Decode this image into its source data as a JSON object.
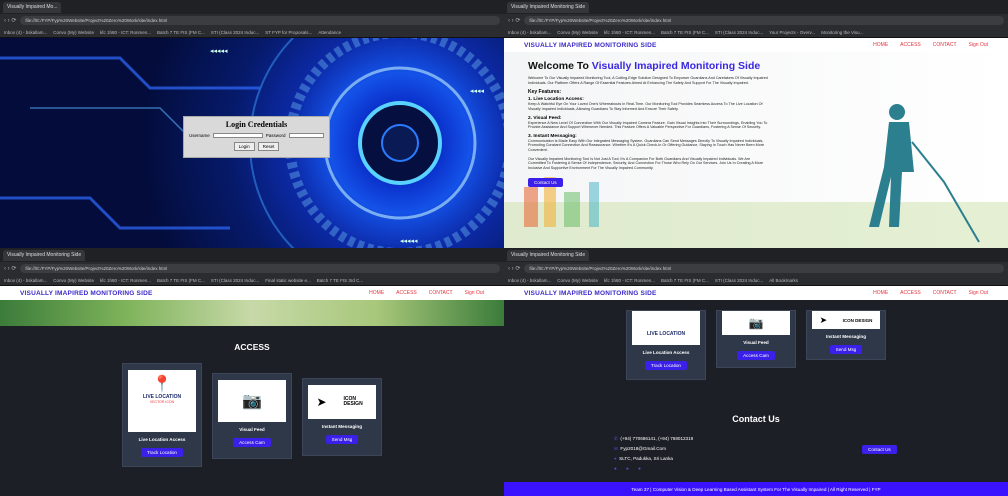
{
  "browser": {
    "tabs": [
      "Visually Impaired Mo...",
      "Visually Impaired Monitoring Side"
    ],
    "url": "file:///E:/FYP/Fyp%20Website/Project%20Zero%20Work/site/index.html",
    "bookmarks": [
      "Inbox (4) - bskallam...",
      "Convo (My) Website",
      "kfc 1h80 - ICT: Ronmen...",
      "Batch 7 TE FIS (FM C...",
      "STI (Class 2024 Induc...",
      "ST FYP for Proposals...",
      "Attendance",
      "Your Projects - Overv...",
      "Monitoring the Visu...",
      "Final static website e...",
      "Batch 7 TE FIS 3rd C...",
      "All Bookmarks"
    ]
  },
  "login": {
    "title": "Login Credentials",
    "username_label": "Username",
    "password_label": "Password",
    "login_btn": "Login",
    "reset_btn": "Reset"
  },
  "nav": {
    "brand": "VISUALLY IMAPIRED MONITORING SIDE",
    "links": [
      "HOME",
      "ACCESS",
      "CONTACT",
      "Sign Out"
    ]
  },
  "hero": {
    "title_prefix": "Welcome To",
    "title_highlight": "Visually Imapired Monitoring Side",
    "intro": "Welcome To Our Visually Impaired Monitoring Tool, A Cutting-Edge Solution Designed To Empower Guardians And Caretakers Of Visually Impaired Individuals. Our Platform Offers A Range Of Essential Features Aimed At Enhancing The Safety And Support For The Visually Impaired.",
    "features_heading": "Key Features:",
    "f1_title": "1. Live Location Access:",
    "f1_text": "Keep A Watchful Eye On Your Loved One's Whereabouts In Real-Time. Our Monitoring Tool Provides Seamless Access To The Live Location Of Visually Impaired Individuals, Allowing Guardians To Stay Informed And Ensure Their Safety.",
    "f2_title": "2. Visual Feed:",
    "f2_text": "Experience A New Level Of Connection With Our Visually Impaired Camera Feature. Gain Visual Insights Into Their Surroundings, Enabling You To Provide Assistance And Support Whenever Needed. This Feature Offers A Valuable Perspective For Guardians, Fostering A Sense Of Security.",
    "f3_title": "3. Instant Messaging:",
    "f3_text": "Communication Is Made Easy With Our Integrated Messaging System. Guardians Can Send Messages Directly To Visually Impaired Individuals, Promoting Constant Connection And Reassurance. Whether It's A Quick Check-In Or Offering Guidance, Staying In Touch Has Never Been More Convenient.",
    "outro": "Our Visually Impaired Monitoring Tool Is Not Just A Tool; It's A Companion For Both Guardians And Visually Impaired Individuals. We Are Committed To Fostering A Sense Of Independence, Security, And Connection For Those Who Rely On Our Services. Join Us In Creating A More Inclusive And Supportive Environment For The Visually Impaired Community.",
    "contact_btn": "Contact Us"
  },
  "access": {
    "heading": "ACCESS",
    "cards": [
      {
        "label": "Live Location Access",
        "button": "Track Location",
        "img_title": "LIVE LOCATION",
        "img_sub": "VECTOR ICON"
      },
      {
        "label": "Visual Feed",
        "button": "Access Cam"
      },
      {
        "label": "Instant Messaging",
        "button": "Send Msg",
        "img_title": "ICON DESIGN"
      }
    ]
  },
  "contact": {
    "heading": "Contact Us",
    "phones": "(+94) 770686141,   (+94) 768012319",
    "email": "Fyp2018@Gmail.Com",
    "address": "SLTC, Padukka, Sri Lanka",
    "button": "Contact Us"
  },
  "footer": {
    "text": "Team 37 | Computer Vision & Deep Learning Based Assistant System For The Visually Impaired | All Right Reserved | FYP"
  }
}
